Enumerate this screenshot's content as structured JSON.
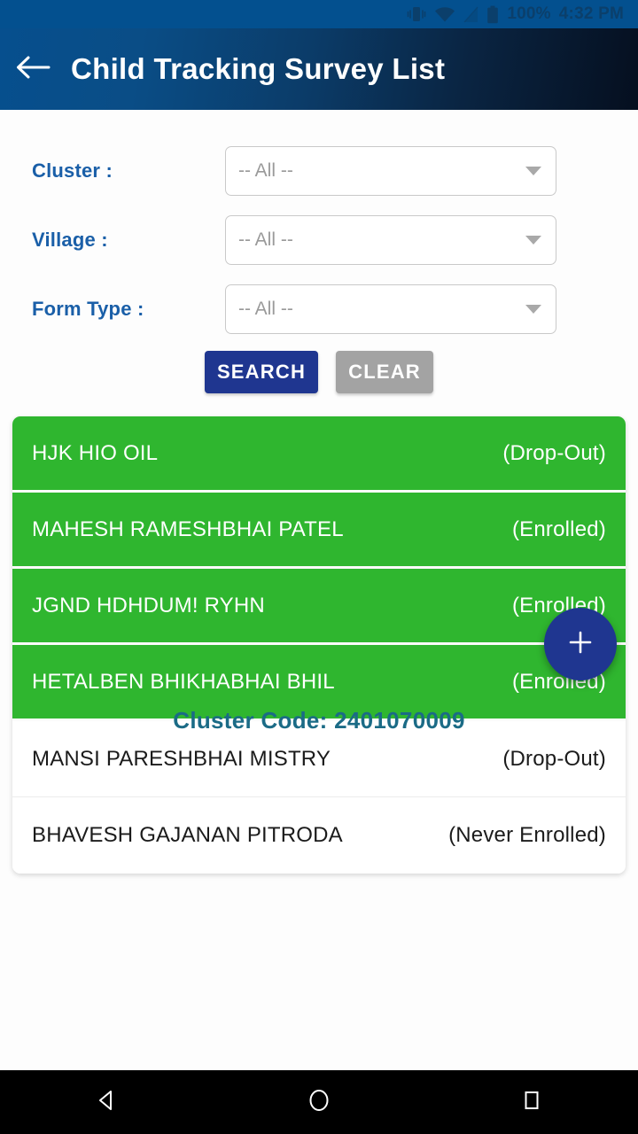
{
  "status_bar": {
    "battery_percent": "100%",
    "time": "4:32 PM",
    "icons": [
      "vibrate-icon",
      "wifi-icon",
      "signal-icon",
      "battery-icon"
    ]
  },
  "app_bar": {
    "back_icon": "back-arrow-icon",
    "title": "Child Tracking Survey List"
  },
  "filters": [
    {
      "label": "Cluster :",
      "value": "-- All --",
      "name": "cluster"
    },
    {
      "label": "Village :",
      "value": "-- All --",
      "name": "village"
    },
    {
      "label": "Form Type :",
      "value": "-- All --",
      "name": "form-type"
    }
  ],
  "buttons": {
    "search_label": "SEARCH",
    "clear_label": "CLEAR"
  },
  "list": {
    "rows": [
      {
        "name": "HJK HIO OIL",
        "status": "(Drop-Out)",
        "highlighted": true
      },
      {
        "name": "MAHESH RAMESHBHAI PATEL",
        "status": "(Enrolled)",
        "highlighted": true
      },
      {
        "name": "JGND HDHDUM! RYHN",
        "status": "(Enrolled)",
        "highlighted": true
      },
      {
        "name": "HETALBEN BHIKHABHAI BHIL",
        "status": "(Enrolled)",
        "highlighted": true
      },
      {
        "name": "MANSI PARESHBHAI MISTRY",
        "status": "(Drop-Out)",
        "highlighted": false
      },
      {
        "name": "BHAVESH GAJANAN PITRODA",
        "status": "(Never Enrolled)",
        "highlighted": false
      }
    ]
  },
  "fab": {
    "icon": "plus-icon"
  },
  "footer": {
    "text": "Cluster Code: 2401070009"
  },
  "nav_bar": {
    "back": "nav-back-icon",
    "home": "nav-home-icon",
    "recents": "nav-recents-icon"
  },
  "colors": {
    "status_bar": "#03508f",
    "appbar_start": "#064f8e",
    "appbar_end": "#050f1f",
    "label_blue": "#1a5fa8",
    "search_blue": "#1f3690",
    "clear_gray": "#a3a3a3",
    "row_green": "#2fb62f",
    "footer_teal": "#1b6b86"
  }
}
